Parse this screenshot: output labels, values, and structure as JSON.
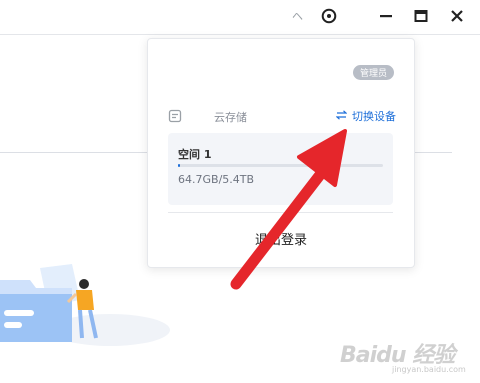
{
  "titlebar": {
    "redacted_text": "ヘ",
    "icons": [
      "settings-icon",
      "minimize-icon",
      "maximize-icon",
      "close-icon"
    ]
  },
  "popup": {
    "role_badge": "管理员",
    "storage_label": "云存储",
    "switch_device_label": "切换设备",
    "space": {
      "name": "空间 1",
      "usage": "64.7GB/5.4TB",
      "used_fraction": 0.012
    },
    "logout_label": "退出登录"
  },
  "watermark": {
    "text": "Baidu 经验",
    "sub": "jingyan.baidu.com"
  },
  "colors": {
    "accent": "#1e6fd9",
    "arrow": "#e5262b",
    "badge": "#b8bdc6"
  }
}
